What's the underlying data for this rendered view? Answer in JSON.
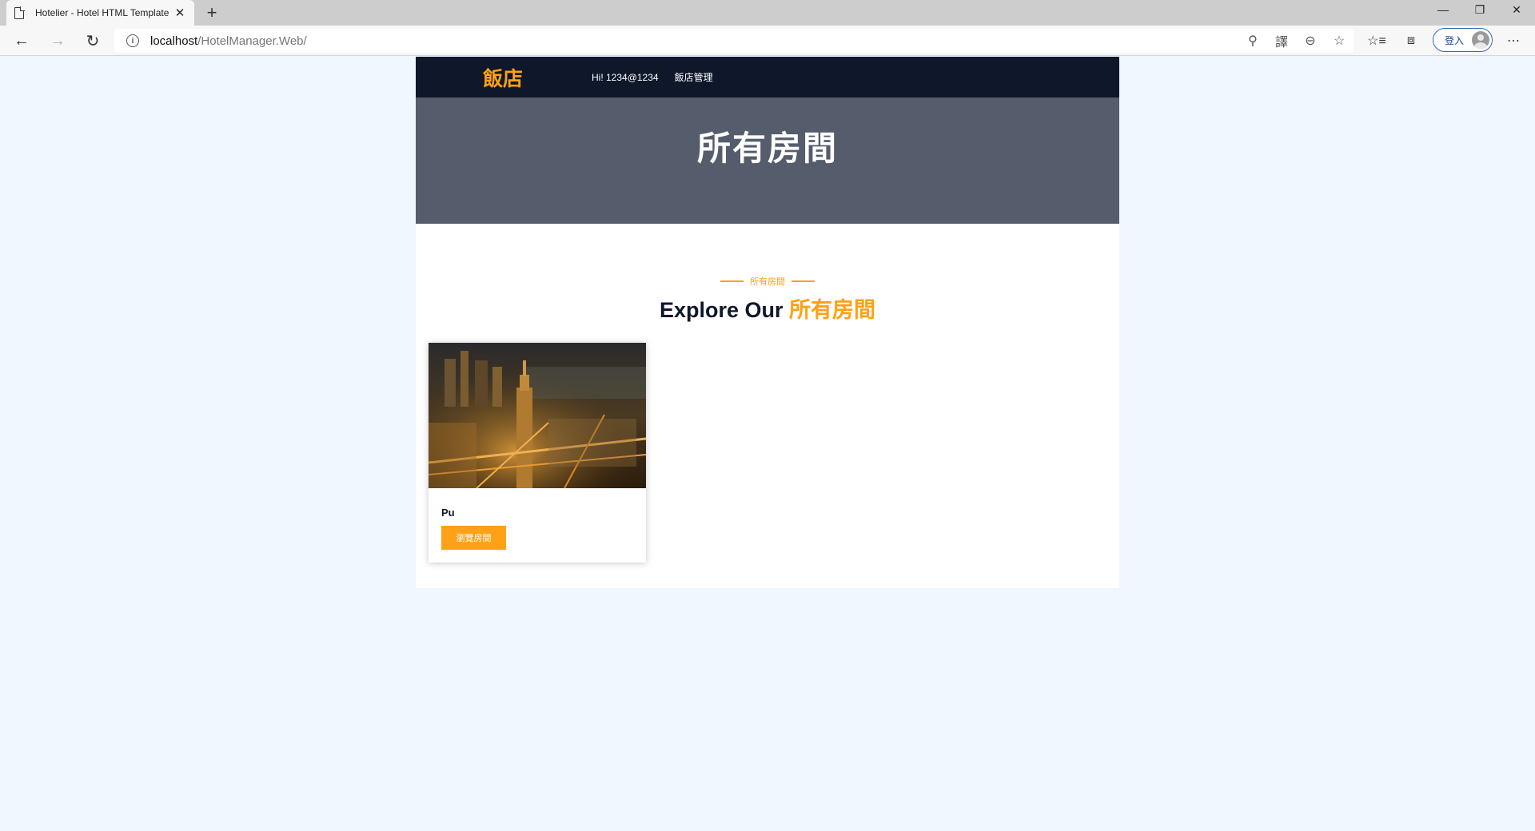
{
  "browser": {
    "tab_title": "Hotelier - Hotel HTML Template",
    "url_host": "localhost",
    "url_path": "/HotelManager.Web/",
    "login_label": "登入"
  },
  "site": {
    "brand": "飯店",
    "nav": [
      "Hi! 1234@1234",
      "飯店管理"
    ],
    "hero_title": "所有房間",
    "section_kicker": "所有房間",
    "section_title_main": "Explore Our",
    "section_title_accent": "所有房間",
    "rooms": [
      {
        "name": "Pu",
        "button_label": "瀏覽房間"
      }
    ]
  },
  "colors": {
    "accent": "#fea116",
    "navbar": "#0f172b",
    "hero": "#555c6c",
    "page_bg": "#f1f7fe"
  }
}
